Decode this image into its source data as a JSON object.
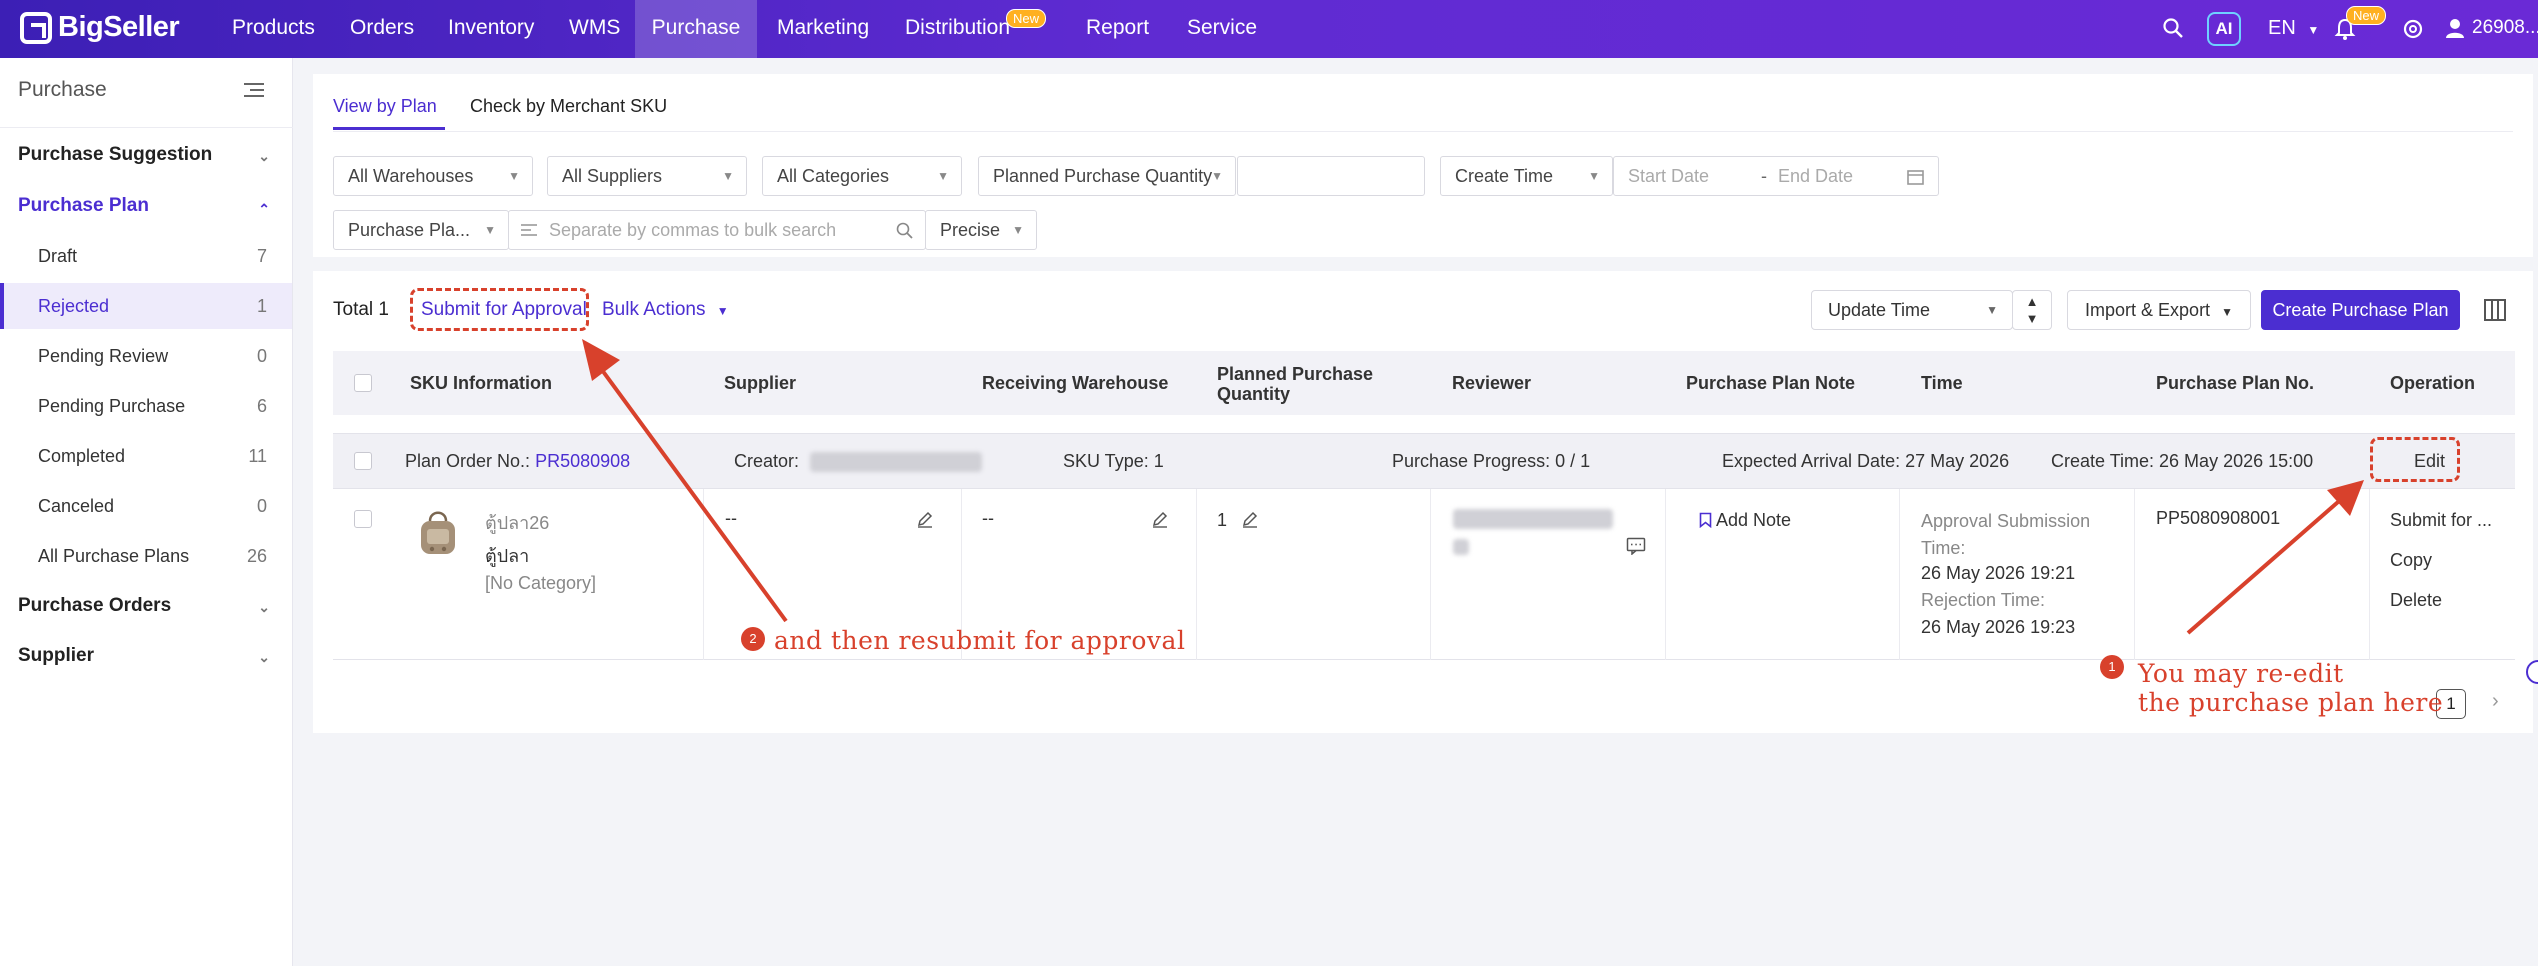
{
  "brand": {
    "logo_text": "BigSeller"
  },
  "topnav": {
    "items": [
      "Products",
      "Orders",
      "Inventory",
      "WMS",
      "Purchase",
      "Marketing",
      "Distribution",
      "Report",
      "Service"
    ],
    "active": "Purchase",
    "new_badge": "New",
    "ai_label": "AI",
    "language": "EN",
    "user": "26908..."
  },
  "sidebar": {
    "title": "Purchase",
    "groups": {
      "suggestion": "Purchase Suggestion",
      "plan": "Purchase Plan",
      "orders": "Purchase Orders",
      "supplier": "Supplier"
    },
    "plan_items": [
      {
        "label": "Draft",
        "count": "7"
      },
      {
        "label": "Rejected",
        "count": "1"
      },
      {
        "label": "Pending Review",
        "count": "0"
      },
      {
        "label": "Pending Purchase",
        "count": "6"
      },
      {
        "label": "Completed",
        "count": "11"
      },
      {
        "label": "Canceled",
        "count": "0"
      },
      {
        "label": "All Purchase Plans",
        "count": "26"
      }
    ]
  },
  "tabs": {
    "by_plan": "View by Plan",
    "by_sku": "Check by Merchant SKU"
  },
  "filters": {
    "warehouses": "All Warehouses",
    "suppliers": "All Suppliers",
    "categories": "All Categories",
    "planned_qty": "Planned Purchase Quantity",
    "create_time": "Create Time",
    "start_date": "Start Date",
    "end_date": "End Date",
    "search_field": "Purchase Pla...",
    "search_placeholder": "Separate by commas to bulk search",
    "match_mode": "Precise"
  },
  "toolbar": {
    "total": "Total 1",
    "submit_approval": "Submit for Approval",
    "bulk_actions": "Bulk Actions",
    "sort": "Update Time",
    "import_export": "Import & Export",
    "create": "Create Purchase Plan"
  },
  "table": {
    "headers": {
      "sku_info": "SKU Information",
      "supplier": "Supplier",
      "receiving_warehouse": "Receiving Warehouse",
      "planned_qty": "Planned Purchase Quantity",
      "reviewer": "Reviewer",
      "note": "Purchase Plan Note",
      "time": "Time",
      "plan_no": "Purchase Plan No.",
      "operation": "Operation"
    },
    "order": {
      "plan_order_label": "Plan Order No.:",
      "plan_order_no": "PR5080908",
      "creator_label": "Creator:",
      "sku_type": "SKU Type: 1",
      "progress": "Purchase Progress: 0 / 1",
      "expected_arrival": "Expected Arrival Date: 27 May 2026",
      "create_time": "Create Time: 26 May 2026 15:00",
      "edit": "Edit"
    },
    "row": {
      "sku_code": "ตู้ปลา26",
      "sku_name": "ตู้ปลา",
      "category": "[No Category]",
      "supplier": "--",
      "warehouse": "--",
      "qty": "1",
      "add_note": "Add Note",
      "approval_label": "Approval Submission Time:",
      "approval_time": "26 May 2026 19:21",
      "rejection_label": "Rejection Time:",
      "rejection_time": "26 May 2026 19:23",
      "plan_no": "PP5080908001",
      "ops": [
        "Submit for ...",
        "Copy",
        "Delete"
      ]
    }
  },
  "annotations": {
    "one_num": "1",
    "one_line1": "You may re-edit",
    "one_line2": "the purchase plan here",
    "two_num": "2",
    "two_text": "and then resubmit for approval",
    "color": "#d8412c"
  },
  "pagination": {
    "page": "1"
  },
  "colors": {
    "primary": "#4b2ed1",
    "nav_start": "#3c1fb5",
    "nav_end": "#6a2ad6"
  }
}
